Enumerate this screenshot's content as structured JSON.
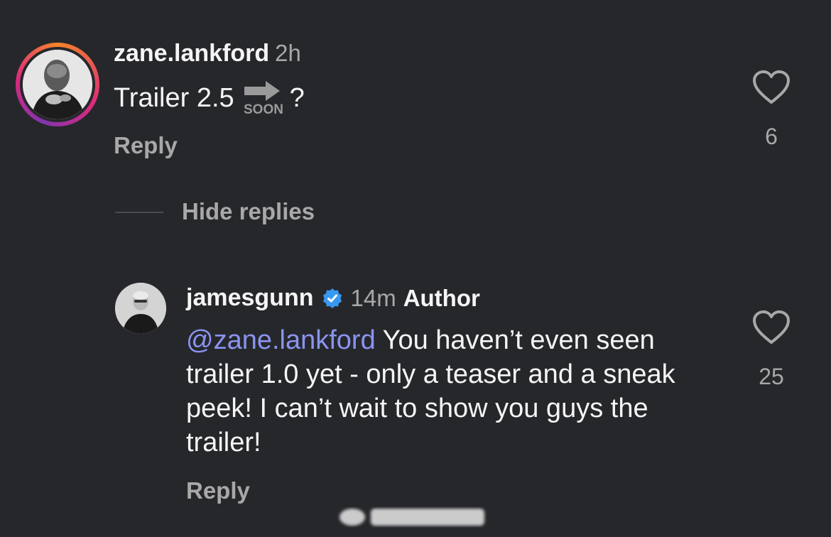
{
  "comment1": {
    "username": "zane.lankford",
    "time": "2h",
    "text_before": "Trailer 2.5 ",
    "emoji": "soon-arrow",
    "emoji_label": "SOON",
    "text_after": "?",
    "reply_label": "Reply",
    "like_count": "6"
  },
  "thread": {
    "hide_replies_label": "Hide replies"
  },
  "comment2": {
    "username": "jamesgunn",
    "verified": true,
    "time": "14m",
    "author_badge": "Author",
    "mention": "@zane.lankford",
    "text": " You haven’t even seen trailer 1.0 yet - only a teaser and a sneak peek! I can’t wait to show you guys the trailer!",
    "reply_label": "Reply",
    "like_count": "25"
  },
  "colors": {
    "background": "#26272b",
    "primary_text": "#f5f5f5",
    "secondary_text": "#a8a8a8",
    "mention": "#8a94f0",
    "verified": "#3897f0"
  },
  "icons": [
    "heart-icon",
    "verified-badge-icon",
    "soon-arrow-emoji"
  ]
}
